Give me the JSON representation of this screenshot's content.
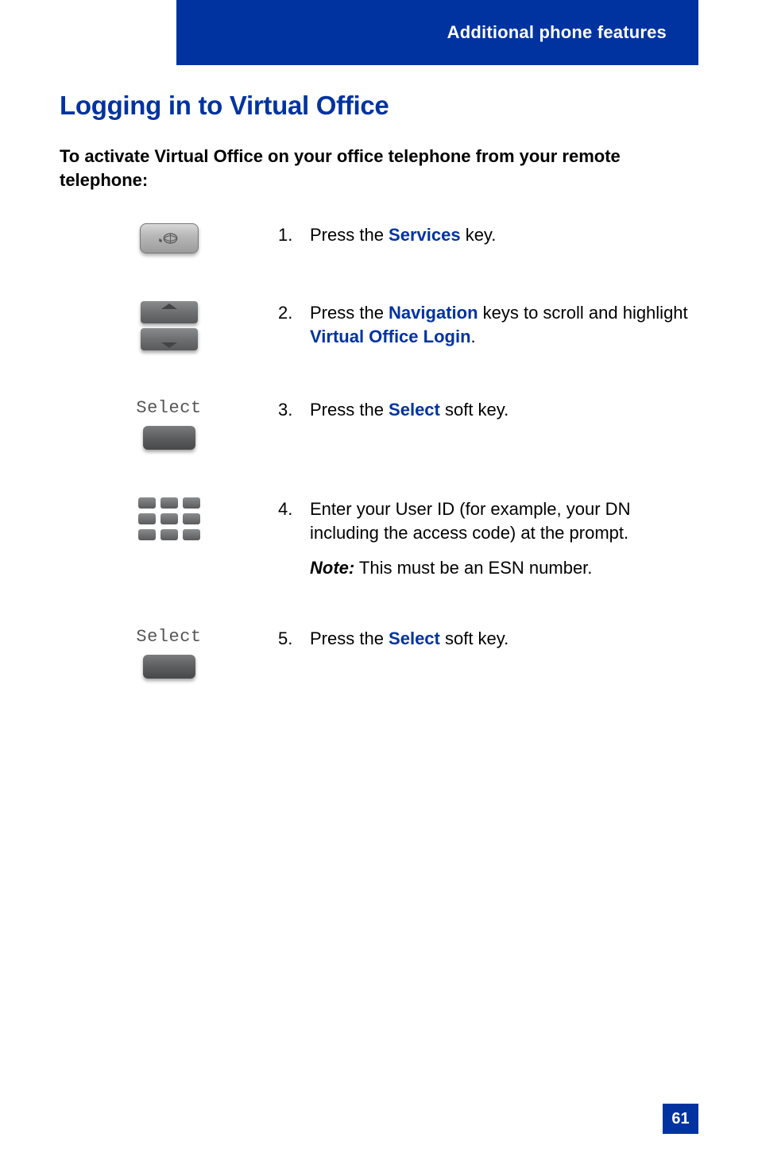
{
  "header": {
    "section": "Additional phone features"
  },
  "title": "Logging in to Virtual Office",
  "intro": "To activate Virtual Office on your office telephone from your remote telephone:",
  "softkey_label": "Select",
  "steps": {
    "s1": {
      "num": "1.",
      "pre": "Press the ",
      "kw": "Services",
      "post": " key."
    },
    "s2": {
      "num": "2.",
      "pre": "Press the ",
      "kw1": "Navigation",
      "mid": " keys to scroll and highlight ",
      "kw2": "Virtual Office Login",
      "post": "."
    },
    "s3": {
      "num": "3.",
      "pre": "Press the ",
      "kw": "Select",
      "post": " soft key."
    },
    "s4": {
      "num": "4.",
      "text": "Enter your User ID (for example, your DN including the access code) at the prompt.",
      "note_label": "Note:",
      "note_text": " This must be an ESN number."
    },
    "s5": {
      "num": "5.",
      "pre": "Press the ",
      "kw": "Select",
      "post": " soft key."
    }
  },
  "page_number": "61"
}
